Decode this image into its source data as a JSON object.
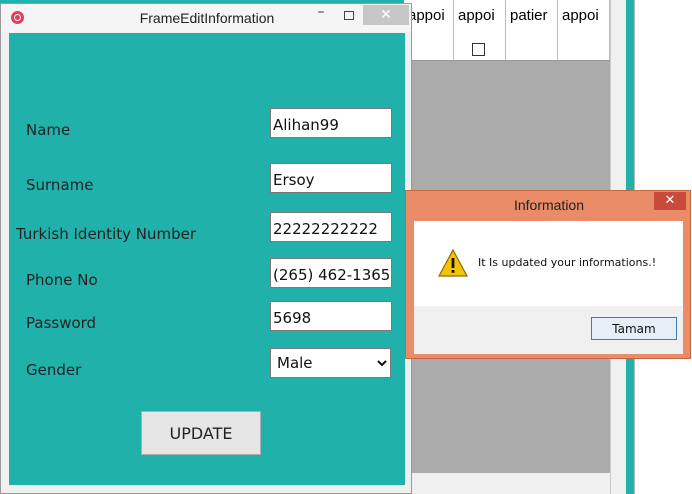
{
  "background_table": {
    "headers": [
      "appoi",
      "appoi",
      "patier",
      "appoi"
    ],
    "top_cut_labels": "appoi appoi"
  },
  "frame": {
    "title": "FrameEditInformation",
    "minimize_glyph": "–",
    "close_glyph": "✕",
    "fields": {
      "name": {
        "label": "Name",
        "value": "Alihan99"
      },
      "surname": {
        "label": "Surname",
        "value": "Ersoy"
      },
      "tc": {
        "label": "Turkish Identity Number",
        "value": "22222222222"
      },
      "phone": {
        "label": "Phone No",
        "value": "(265) 462-1365"
      },
      "password": {
        "label": "Password",
        "value": "5698"
      },
      "gender": {
        "label": "Gender",
        "value": "Male"
      }
    },
    "update_label": "UPDATE"
  },
  "dialog": {
    "title": "Information",
    "close_glyph": "✕",
    "message": "It Is updated your informations.!",
    "ok_label": "Tamam",
    "icon": "warning-icon"
  },
  "colors": {
    "content_bg": "#20b2aa",
    "dialog_frame": "#e98c67",
    "dialog_close": "#c74a3a"
  }
}
